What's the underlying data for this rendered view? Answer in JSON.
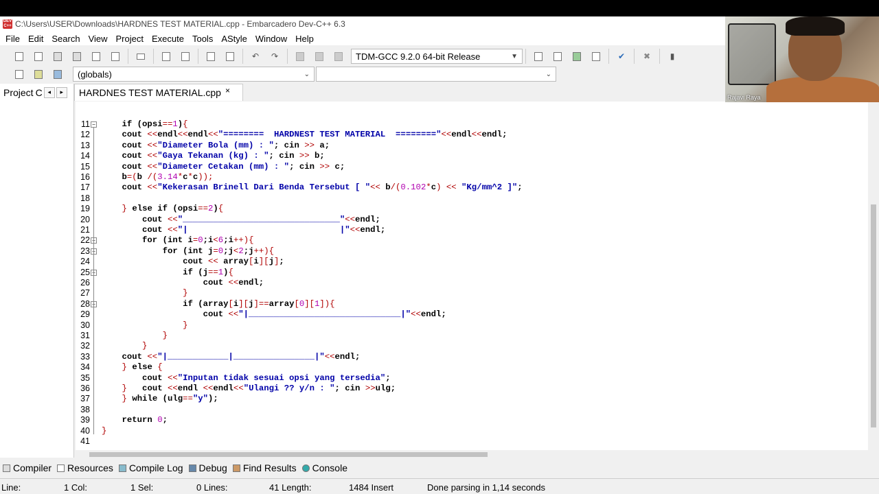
{
  "window": {
    "title": "C:\\Users\\USER\\Downloads\\HARDNES TEST MATERIAL.cpp - Embarcadero Dev-C++ 6.3",
    "icon_text": "DEV C++"
  },
  "menu": [
    "File",
    "Edit",
    "Search",
    "View",
    "Project",
    "Execute",
    "Tools",
    "AStyle",
    "Window",
    "Help"
  ],
  "toolbar": {
    "compiler_select": "TDM-GCC 9.2.0 64-bit Release",
    "scope_select": "(globals)",
    "member_select": ""
  },
  "tabs": {
    "project_label": "Project",
    "project_c": "C",
    "nav_prev": "◂",
    "nav_next": "▸",
    "file_tab": "HARDNES TEST MATERIAL.cpp",
    "close": "×"
  },
  "editor": {
    "lines": [
      {
        "n": "11",
        "fold": "−"
      },
      {
        "n": "12"
      },
      {
        "n": "13"
      },
      {
        "n": "14"
      },
      {
        "n": "15"
      },
      {
        "n": "16"
      },
      {
        "n": "17"
      },
      {
        "n": "18"
      },
      {
        "n": "19"
      },
      {
        "n": "20"
      },
      {
        "n": "21"
      },
      {
        "n": "22",
        "fold": "−"
      },
      {
        "n": "23",
        "fold": "−"
      },
      {
        "n": "24"
      },
      {
        "n": "25",
        "fold": "−"
      },
      {
        "n": "26"
      },
      {
        "n": "27"
      },
      {
        "n": "28",
        "fold": "−"
      },
      {
        "n": "29"
      },
      {
        "n": "30"
      },
      {
        "n": "31"
      },
      {
        "n": "32"
      },
      {
        "n": "33"
      },
      {
        "n": "34"
      },
      {
        "n": "35"
      },
      {
        "n": "36"
      },
      {
        "n": "37"
      },
      {
        "n": "38"
      },
      {
        "n": "39"
      },
      {
        "n": "40"
      },
      {
        "n": "41"
      }
    ]
  },
  "bottom_tabs": [
    "Compiler",
    "Resources",
    "Compile Log",
    "Debug",
    "Find Results",
    "Console"
  ],
  "status": {
    "line_label": "Line:",
    "line_val": "1 Col:",
    "col_val": "1 Sel:",
    "sel_val": "0 Lines:",
    "lines_val": "41 Length:",
    "length_val": "1484 Insert",
    "message": "Done parsing in 1,14 seconds"
  },
  "webcam": {
    "name": "Rajavi Raya"
  }
}
